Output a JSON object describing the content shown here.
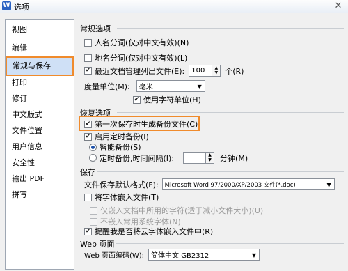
{
  "window": {
    "title": "选项",
    "app_icon": "W",
    "close_glyph": "✕"
  },
  "sidebar": {
    "items": [
      {
        "label": "视图"
      },
      {
        "label": "编辑"
      },
      {
        "label": "常规与保存"
      },
      {
        "label": "打印"
      },
      {
        "label": "修订"
      },
      {
        "label": "中文版式"
      },
      {
        "label": "文件位置"
      },
      {
        "label": "用户信息"
      },
      {
        "label": "安全性"
      },
      {
        "label": "输出 PDF"
      },
      {
        "label": "拼写"
      }
    ],
    "active_index": 2
  },
  "general": {
    "header": "常规选项",
    "name_word_seg": "人名分词(仅对中文有效)(N)",
    "place_word_seg": "地名分词(仅对中文有效)(L)",
    "recent_docs": "最近文档管理列出文件(E):",
    "recent_docs_value": "100",
    "recent_docs_unit": "个(R)",
    "measure_label": "度量单位(M):",
    "measure_value": "毫米",
    "use_char_unit": "使用字符单位(H)"
  },
  "recovery": {
    "header": "恢复选项",
    "first_backup": "第一次保存时生成备份文件(C)",
    "enable_timed": "启用定时备份(I)",
    "smart_backup": "智能备份(S)",
    "timed_backup": "定时备份,时间间隔(I):",
    "interval_value": "",
    "minutes": "分钟(M)"
  },
  "save": {
    "header": "保存",
    "default_format_label": "文件保存默认格式(F):",
    "default_format_value": "Microsoft Word 97/2000/XP/2003 文件(*.doc)",
    "embed_fonts": "将字体嵌入文件(T)",
    "embed_used_only": "仅嵌入文档中所用的字符(适于减小文件大小)(U)",
    "no_common_fonts": "不嵌入常用系统字体(N)",
    "remind_cloud_fonts": "提醒我是否将云字体嵌入文件中(R)"
  },
  "web": {
    "header": "Web 页面",
    "encoding_label": "Web 页面编码(W):",
    "encoding_value": "简体中文 GB2312"
  },
  "states": {
    "name_word_seg": false,
    "place_word_seg": false,
    "recent_docs": true,
    "use_char_unit": true,
    "first_backup": true,
    "enable_timed": true,
    "smart_backup": true,
    "timed_backup": false,
    "embed_fonts": false,
    "embed_used_only": false,
    "no_common_fonts": false,
    "remind_cloud_fonts": true
  }
}
